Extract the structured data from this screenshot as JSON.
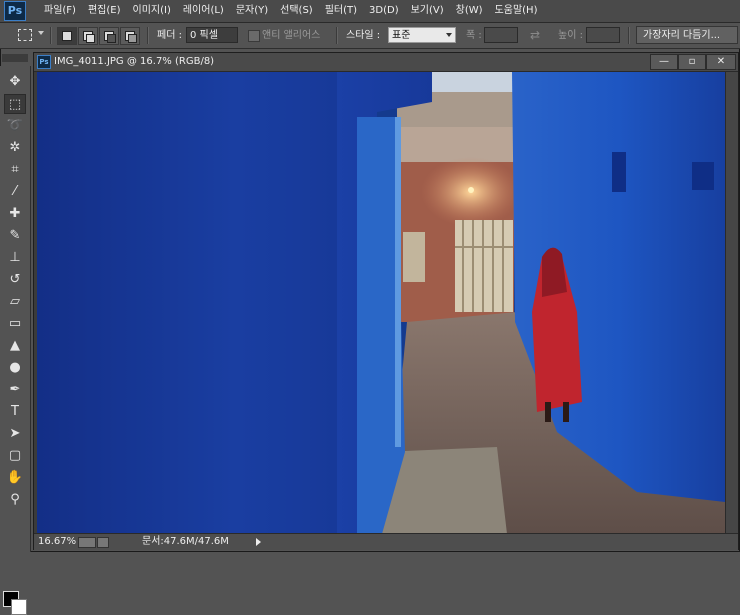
{
  "app": {
    "logo": "Ps",
    "menu": [
      "파일(F)",
      "편집(E)",
      "이미지(I)",
      "레이어(L)",
      "문자(Y)",
      "선택(S)",
      "필터(T)",
      "3D(D)",
      "보기(V)",
      "창(W)",
      "도움말(H)"
    ]
  },
  "options": {
    "feather_label": "페더 :",
    "feather_value": "0 픽셀",
    "antialias_label": "앤티 앨리어스",
    "style_label": "스타일 :",
    "style_value": "표준",
    "width_label": "폭 :",
    "height_label": "높이 :",
    "refine_edge_label": "가장자리 다듬기..."
  },
  "tools": [
    {
      "name": "move-tool",
      "glyph": "✥",
      "active": false
    },
    {
      "name": "rectangular-marquee-tool",
      "glyph": "⬚",
      "active": true
    },
    {
      "name": "lasso-tool",
      "glyph": "➰",
      "active": false
    },
    {
      "name": "magic-wand-tool",
      "glyph": "✲",
      "active": false
    },
    {
      "name": "crop-tool",
      "glyph": "⌗",
      "active": false
    },
    {
      "name": "eyedropper-tool",
      "glyph": "⁄",
      "active": false
    },
    {
      "name": "spot-healing-tool",
      "glyph": "✚",
      "active": false
    },
    {
      "name": "brush-tool",
      "glyph": "✎",
      "active": false
    },
    {
      "name": "clone-stamp-tool",
      "glyph": "⊥",
      "active": false
    },
    {
      "name": "history-brush-tool",
      "glyph": "↺",
      "active": false
    },
    {
      "name": "eraser-tool",
      "glyph": "▱",
      "active": false
    },
    {
      "name": "gradient-tool",
      "glyph": "▭",
      "active": false
    },
    {
      "name": "blur-tool",
      "glyph": "▲",
      "active": false
    },
    {
      "name": "dodge-tool",
      "glyph": "●",
      "active": false
    },
    {
      "name": "pen-tool",
      "glyph": "✒",
      "active": false
    },
    {
      "name": "type-tool",
      "glyph": "T",
      "active": false
    },
    {
      "name": "path-selection-tool",
      "glyph": "➤",
      "active": false
    },
    {
      "name": "rectangle-shape-tool",
      "glyph": "▢",
      "active": false
    },
    {
      "name": "hand-tool",
      "glyph": "✋",
      "active": false
    },
    {
      "name": "zoom-tool",
      "glyph": "⚲",
      "active": false
    }
  ],
  "document": {
    "title": "IMG_4011.JPG @ 16.7% (RGB/8)",
    "icon": "Ps"
  },
  "window_buttons": {
    "minimize": "—",
    "restore": "▫",
    "close": "✕"
  },
  "status": {
    "zoom": "16.67%",
    "doc_size": "문서:47.6M/47.6M"
  },
  "colors": {
    "foreground": "#000000",
    "background": "#ffffff",
    "ui_panel": "#535353",
    "photo_blue": "#1d4fc0"
  }
}
